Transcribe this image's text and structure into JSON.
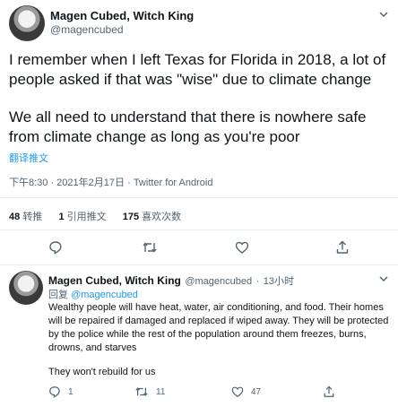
{
  "tweet": {
    "author_name": "Magen Cubed, Witch King",
    "author_handle": "@magencubed",
    "text_para1": "I remember when I left Texas for Florida in 2018, a lot of people asked if that was \"wise\" due to climate change",
    "text_para2": "We all need to understand that there is nowhere safe from climate change as long as you're poor",
    "translate_label": "翻译推文",
    "timestamp": "下午8:30 · 2021年2月17日",
    "source": "Twitter for Android",
    "stats": {
      "retweets_count": "48",
      "retweets_label": "转推",
      "quotes_count": "1",
      "quotes_label": "引用推文",
      "likes_count": "175",
      "likes_label": "喜欢次数"
    }
  },
  "reply": {
    "author_name": "Magen Cubed, Witch King",
    "author_handle": "@magencubed",
    "time_ago": "13小时",
    "replying_prefix": "回复",
    "replying_to": "@magencubed",
    "text_para1": "Wealthy people will have heat, water, air conditioning, and food. Their homes will be repaired if damaged and replaced if wiped away. They will be protected by the police while the rest of the population around them freezes, burns, drowns, and starves",
    "text_para2": "They won't rebuild for us",
    "reply_count": "1",
    "retweet_count": "11",
    "like_count": "47"
  },
  "icons": {
    "more": "chevron-down-icon",
    "reply": "comment-icon",
    "retweet": "retweet-icon",
    "like": "heart-icon",
    "share": "share-icon"
  },
  "colors": {
    "link": "#1d9bf0",
    "secondary_text": "#536471",
    "divider": "#e6ecf0"
  }
}
